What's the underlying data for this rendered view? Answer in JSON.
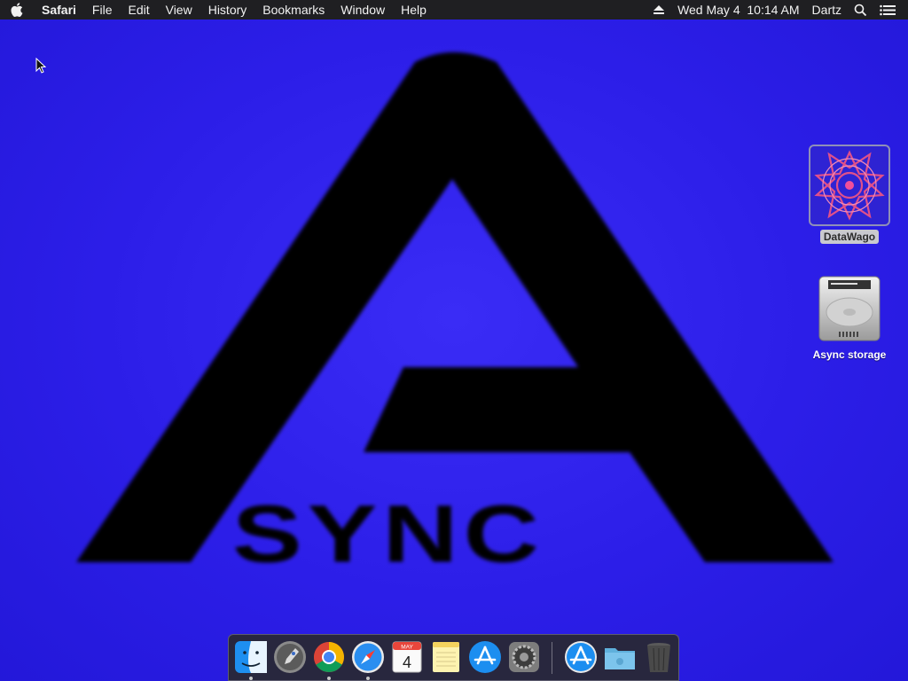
{
  "menubar": {
    "apple_icon": "apple-icon",
    "app_name": "Safari",
    "menus": [
      "File",
      "Edit",
      "View",
      "History",
      "Bookmarks",
      "Window",
      "Help"
    ],
    "status": {
      "eject_icon": "eject-icon",
      "clock": "Wed May 4  10:14 AM",
      "user": "Dartz",
      "spotlight_icon": "search-icon",
      "notification_icon": "list-icon"
    }
  },
  "desktop": {
    "wallpaper_text": "SYNC",
    "wallpaper_color": "#2f1ff0",
    "icons": [
      {
        "label": "DataWago",
        "icon": "datawago-app-icon",
        "selected": true
      },
      {
        "label": "Async storage",
        "icon": "hard-drive-icon",
        "selected": false
      }
    ]
  },
  "dock": {
    "apps": [
      {
        "name": "Finder",
        "icon": "finder-icon",
        "running": true
      },
      {
        "name": "Launchpad",
        "icon": "launchpad-icon",
        "running": false
      },
      {
        "name": "Google Chrome",
        "icon": "chrome-icon",
        "running": true
      },
      {
        "name": "Safari",
        "icon": "safari-icon",
        "running": true
      },
      {
        "name": "Calendar",
        "icon": "calendar-icon",
        "running": false,
        "month": "MAY",
        "day": "4"
      },
      {
        "name": "Notes",
        "icon": "notes-icon",
        "running": false
      },
      {
        "name": "App Store",
        "icon": "app-store-icon",
        "running": false
      },
      {
        "name": "System Preferences",
        "icon": "system-preferences-icon",
        "running": false
      },
      {
        "name": "App Store Downloads",
        "icon": "app-store-icon",
        "running": false
      },
      {
        "name": "Folder",
        "icon": "folder-icon",
        "running": false
      },
      {
        "name": "Trash",
        "icon": "trash-icon",
        "running": false
      }
    ]
  }
}
